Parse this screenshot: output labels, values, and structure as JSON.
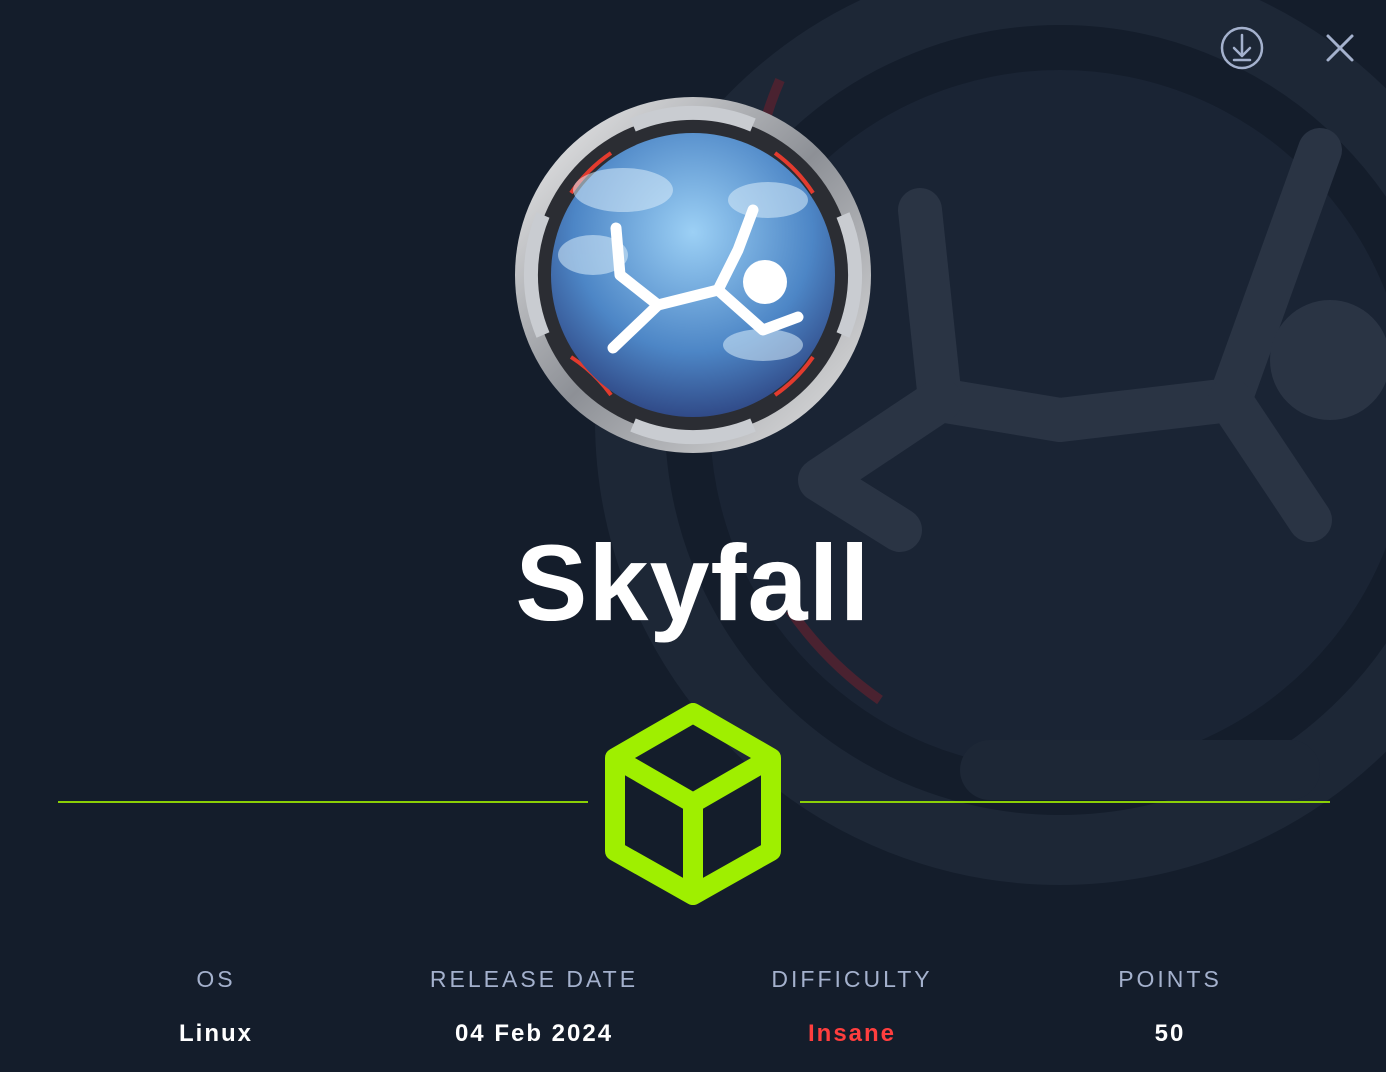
{
  "machine": {
    "name": "Skyfall"
  },
  "actions": {
    "download_icon": "download-circle-icon",
    "close_icon": "close-icon"
  },
  "stats": {
    "os_label": "OS",
    "os_value": "Linux",
    "release_label": "RELEASE DATE",
    "release_value": "04 Feb 2024",
    "difficulty_label": "DIFFICULTY",
    "difficulty_value": "Insane",
    "points_label": "POINTS",
    "points_value": "50"
  },
  "colors": {
    "background": "#141d2b",
    "accent": "#9fef00",
    "label": "#a4b1cd",
    "insane": "#ff3e3e"
  }
}
